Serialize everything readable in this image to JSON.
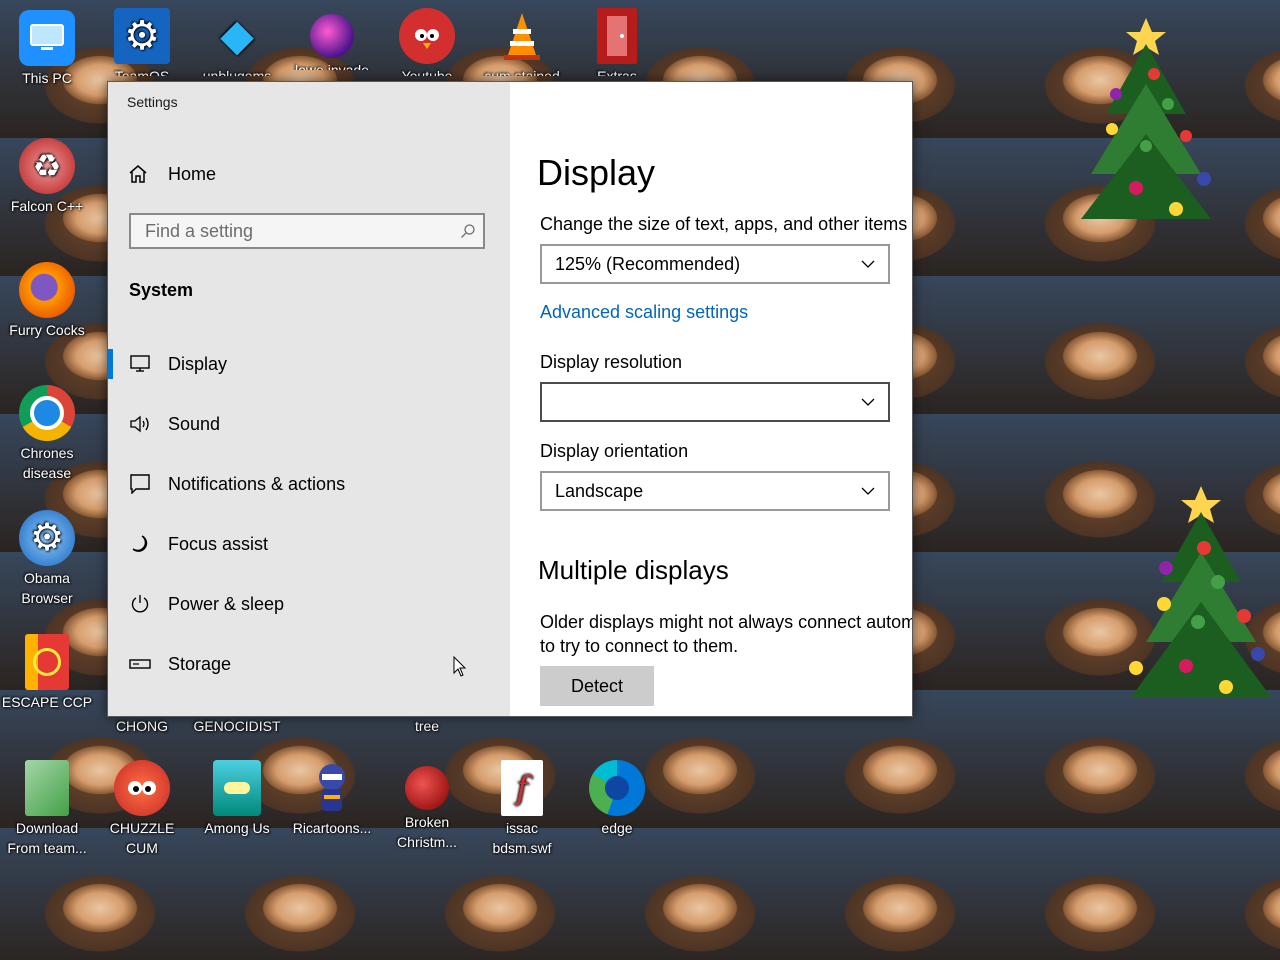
{
  "desktop": {
    "icons_top": [
      {
        "label": "This PC",
        "icon": "monitor-icon",
        "color": "#1e90ff"
      },
      {
        "label": "TeamOS",
        "icon": "gear-icon",
        "color": "#1565c0"
      },
      {
        "label": "unblugems",
        "icon": "diamond-icon",
        "color": "#29b6f6"
      },
      {
        "label": "lowe invade",
        "icon": "orb-icon",
        "color": "#6a1b9a"
      },
      {
        "label": "Youtube",
        "icon": "angry-bird-icon",
        "color": "#d32f2f"
      },
      {
        "label": "cum stained",
        "icon": "traffic-cone-icon",
        "color": "#ff8f00"
      },
      {
        "label": "Extras",
        "icon": "door-icon",
        "color": "#b71c1c"
      }
    ],
    "icons_left": [
      {
        "label": "Falcon C++",
        "icon": "recycle-icon",
        "color": "#c62828"
      },
      {
        "label": "Furry Cocks",
        "icon": "firefox-icon",
        "color": "#ff6f00"
      },
      {
        "label": "Chrones disease",
        "icon": "chrome-icon",
        "color": "#1e88e5"
      },
      {
        "label": "Obama Browser",
        "icon": "settings-gear-icon",
        "color": "#1565c0"
      },
      {
        "label": "ESCAPE CCP",
        "icon": "red-box-icon",
        "color": "#e53935"
      }
    ],
    "icons_bottom_row1": [
      {
        "label": "CHONG"
      },
      {
        "label": "GENOCIDIST"
      },
      {
        "label": "tree"
      }
    ],
    "icons_bottom_row2": [
      {
        "label": "Download From team...",
        "icon": "notepad-icon",
        "color": "#66bb6a"
      },
      {
        "label": "CHUZZLE CUM",
        "icon": "chuzzle-icon",
        "color": "#e53935"
      },
      {
        "label": "Among Us",
        "icon": "among-us-icon",
        "color": "#26a69a"
      },
      {
        "label": "Ricartoons...",
        "icon": "ninja-icon",
        "color": "#283593"
      },
      {
        "label": "Broken Christm...",
        "icon": "ornament-icon",
        "color": "#b71c1c"
      },
      {
        "label": "issac bdsm.swf",
        "icon": "swf-file-icon",
        "color": "#d32f2f"
      },
      {
        "label": "edge",
        "icon": "edge-icon",
        "color": "#0078d7"
      }
    ]
  },
  "window": {
    "title": "Settings",
    "sidebar": {
      "home_label": "Home",
      "search_placeholder": "Find a setting",
      "section": "System",
      "items": [
        {
          "label": "Display",
          "icon": "monitor-icon",
          "active": true
        },
        {
          "label": "Sound",
          "icon": "speaker-icon"
        },
        {
          "label": "Notifications & actions",
          "icon": "notification-icon"
        },
        {
          "label": "Focus assist",
          "icon": "moon-icon"
        },
        {
          "label": "Power & sleep",
          "icon": "power-icon"
        },
        {
          "label": "Storage",
          "icon": "storage-drive-icon"
        }
      ]
    },
    "content": {
      "title": "Display",
      "scale_label": "Change the size of text, apps, and other items",
      "scale_value": "125% (Recommended)",
      "advanced_link": "Advanced scaling settings",
      "resolution_label": "Display resolution",
      "resolution_value": "",
      "orientation_label": "Display orientation",
      "orientation_value": "Landscape",
      "multiple_title": "Multiple displays",
      "multiple_line1": "Older displays might not always connect automa",
      "multiple_line2": "to try to connect to them.",
      "detect_button": "Detect"
    }
  },
  "colors": {
    "accent": "#0078d7",
    "link": "#0067b8",
    "sidebar_bg": "#e6e6e6"
  }
}
